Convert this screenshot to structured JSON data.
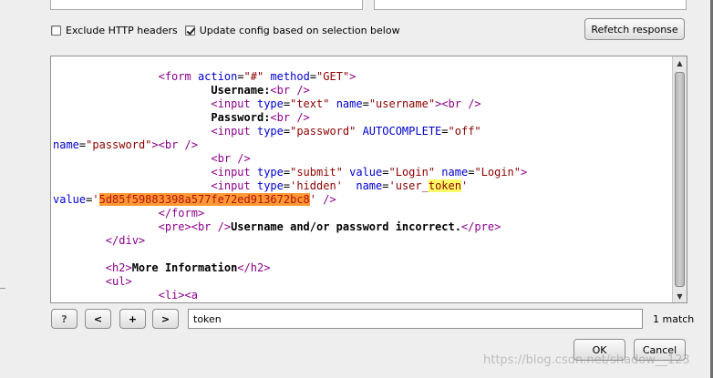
{
  "options": {
    "exclude_headers_label": "Exclude HTTP headers",
    "exclude_headers_checked": false,
    "update_config_label": "Update config based on selection below",
    "update_config_checked": true,
    "refetch_label": "Refetch response"
  },
  "code_lines": {
    "l1_tag1": "<form ",
    "l1_a1": "action",
    "l1_v1": "\"#\"",
    "l1_a2": " method",
    "l1_v2": "\"GET\"",
    "l1_end": ">",
    "l2_text": "Username:",
    "l2_tag": "<br />",
    "l3_tag": "<input ",
    "l3_a1": "type",
    "l3_v1": "\"text\"",
    "l3_a2": " name",
    "l3_v2": "\"username\"",
    "l3_end": "><br />",
    "l4_text": "Password:",
    "l4_tag": "<br />",
    "l5_tag": "<input ",
    "l5_a1": "type",
    "l5_v1": "\"password\"",
    "l5_a2": " AUTOCOMPLETE",
    "l5_v2": "\"off\"",
    "l6_a1": "name",
    "l6_v1": "\"password\"",
    "l6_end": "><br />",
    "l7_tag": "<br />",
    "l8_tag": "<input ",
    "l8_a1": "type",
    "l8_v1": "\"submit\"",
    "l8_a2": " value",
    "l8_v2": "\"Login\"",
    "l8_a3": " name",
    "l8_v3": "\"Login\"",
    "l8_end": ">",
    "l9_tag": "<input ",
    "l9_a1": "type",
    "l9_v1": "'hidden'",
    "l9_a2": "  name",
    "l9_v2a": "'user_",
    "l9_v2b": "token",
    "l9_v2c": "'",
    "l10_a1": "value",
    "l10_q": "'",
    "l10_token": "5d85f59883398a577fe72ed913672bc8",
    "l10_q2": "'",
    "l10_end": " />",
    "l11_tag": "</form>",
    "l12_tag1": "<pre>",
    "l12_tag2": "<br />",
    "l12_text": "Username and/or password incorrect.",
    "l12_tag3": "</pre>",
    "l13_tag": "</div>",
    "l15_tag1": "<h2>",
    "l15_text": "More Information",
    "l15_tag2": "</h2>",
    "l16_tag": "<ul>",
    "l17_tag": "<li><a"
  },
  "search": {
    "help_label": "?",
    "prev_label": "<",
    "add_label": "+",
    "next_label": ">",
    "value": "token",
    "match_count": "1 match"
  },
  "dialog": {
    "ok_label": "OK",
    "cancel_label": "Cancel"
  },
  "watermark": "https://blog.csdn.net/shadow__123"
}
